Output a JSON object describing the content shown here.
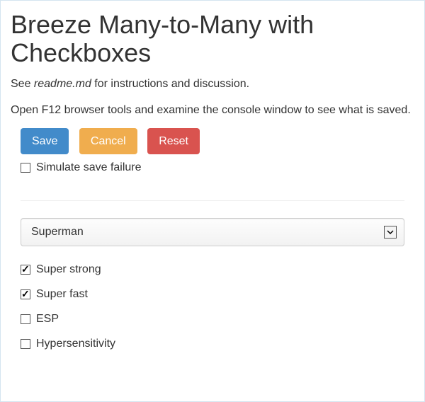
{
  "title": "Breeze Many-to-Many with Checkboxes",
  "intro": {
    "see": "See ",
    "readme": "readme.md",
    "rest": " for instructions and discussion."
  },
  "intro2": "Open F12 browser tools and examine the console window to see what is saved.",
  "buttons": {
    "save": "Save",
    "cancel": "Cancel",
    "reset": "Reset"
  },
  "simulate": {
    "label": "Simulate save failure",
    "checked": false
  },
  "hero": {
    "selected": "Superman"
  },
  "powers": [
    {
      "label": "Super strong",
      "checked": true
    },
    {
      "label": "Super fast",
      "checked": true
    },
    {
      "label": "ESP",
      "checked": false
    },
    {
      "label": "Hypersensitivity",
      "checked": false
    }
  ]
}
